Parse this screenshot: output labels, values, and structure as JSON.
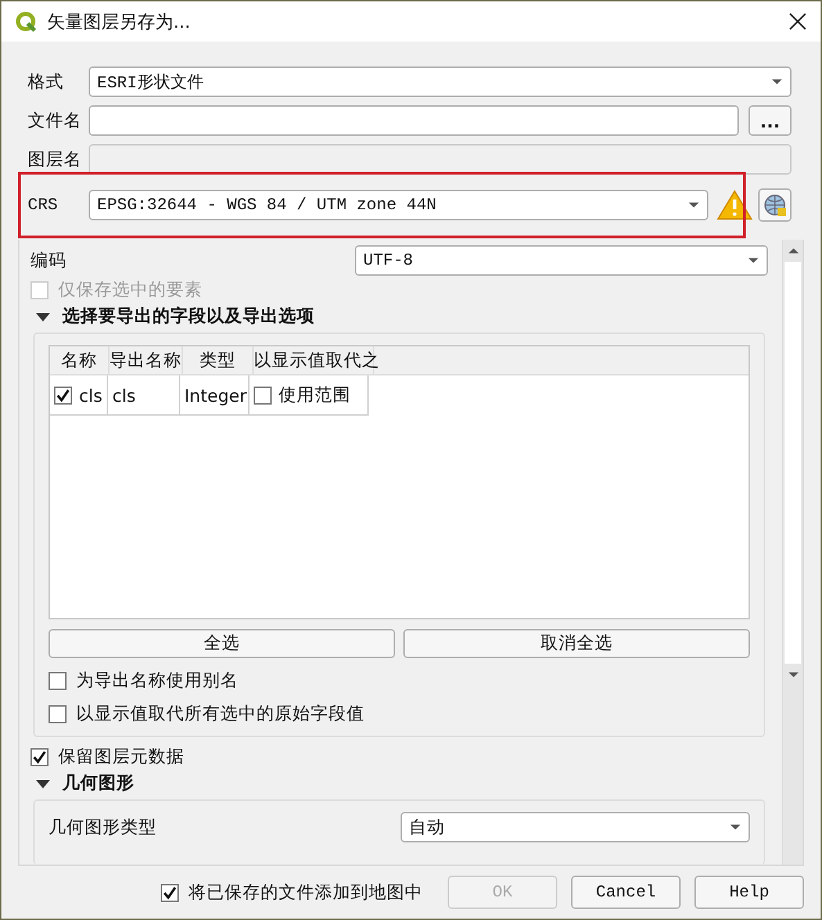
{
  "window": {
    "title": "矢量图层另存为..."
  },
  "form": {
    "format": {
      "label": "格式",
      "value": "ESRI形状文件"
    },
    "file_name": {
      "label": "文件名",
      "browse": "..."
    },
    "layer_name": {
      "label": "图层名",
      "disabled": true
    },
    "crs": {
      "label": "CRS",
      "value": "EPSG:32644 - WGS 84 / UTM zone 44N",
      "highlighted": true,
      "warning": true
    }
  },
  "encoding": {
    "label": "编码",
    "value": "UTF-8"
  },
  "selected_only": {
    "label": "仅保存选中的要素",
    "checked": false,
    "disabled": true
  },
  "fields_section": {
    "title": "选择要导出的字段以及导出选项",
    "expanded": true,
    "columns": [
      "名称",
      "导出名称",
      "类型",
      "以显示值取代之"
    ],
    "rows": [
      {
        "checked": true,
        "name": "cls",
        "export_name": "cls",
        "type": "Integer",
        "replace_checked": false,
        "replace_label": "使用范围"
      }
    ],
    "buttons": [
      "全选",
      "取消全选"
    ],
    "options": [
      {
        "label": "为导出名称使用别名",
        "checked": false
      },
      {
        "label": "以显示值取代所有选中的原始字段值",
        "checked": false
      }
    ]
  },
  "keep_metadata": {
    "label": "保留图层元数据",
    "checked": true
  },
  "geometry_section": {
    "title": "几何图形",
    "expanded": true,
    "type_label": "几何图形类型",
    "type_value": "自动"
  },
  "footer": {
    "add_to_map": {
      "label": "将已保存的文件添加到地图中",
      "checked": true
    },
    "buttons": [
      {
        "label": "OK",
        "disabled": true
      },
      {
        "label": "Cancel",
        "disabled": false
      },
      {
        "label": "Help",
        "disabled": false
      }
    ]
  }
}
